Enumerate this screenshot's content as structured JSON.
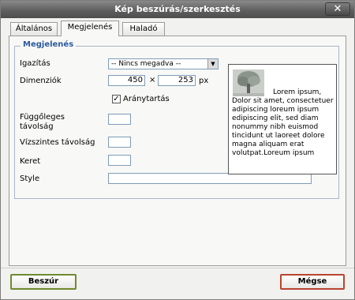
{
  "window": {
    "title": "Kép beszúrás/szerkesztés",
    "close_glyph": "✕"
  },
  "tabs": [
    {
      "label": "Általános",
      "active": false
    },
    {
      "label": "Megjelenés",
      "active": true
    },
    {
      "label": "Haladó",
      "active": false
    }
  ],
  "appearance": {
    "legend": "Megjelenés",
    "align_label": "Igazítás",
    "align_value": "-- Nincs megadva --",
    "dimensions_label": "Dimenziók",
    "width_value": "450",
    "times_symbol": "×",
    "height_value": "253",
    "unit": "px",
    "constrain_label": "Aránytartás",
    "constrain_checked": true,
    "constrain_check_glyph": "✓",
    "vspace_label": "Függőleges távolság",
    "hspace_label": "Vízszintes távolság",
    "border_label": "Keret",
    "style_label": "Style",
    "preview_text": "Lorem ipsum, Dolor sit amet, consectetuer adipiscing loreum ipsum edipiscing elit, sed diam nonummy nibh euismod tincidunt ut laoreet dolore magna aliquam erat volutpat.Loreum ipsum"
  },
  "buttons": {
    "insert": "Beszúr",
    "cancel": "Mégse"
  },
  "colors": {
    "insert_border": "#6f8a2e",
    "cancel_border": "#b9442f",
    "legend": "#2c5aa0"
  }
}
